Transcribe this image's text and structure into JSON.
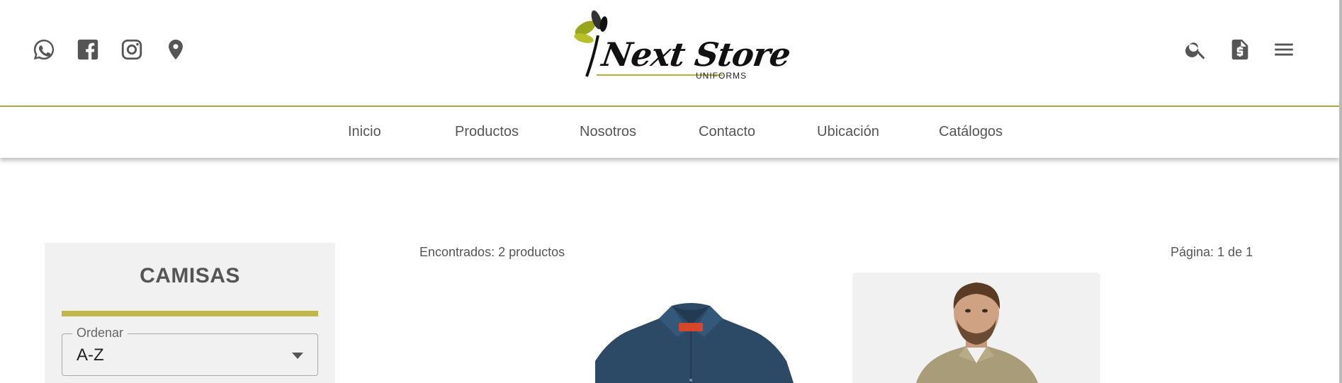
{
  "header": {
    "social_icons": [
      "whatsapp-icon",
      "facebook-icon",
      "instagram-icon",
      "location-pin-icon"
    ],
    "logo": {
      "brand": "Next Store",
      "sub": "UNIFORMS"
    },
    "tool_icons": [
      "search-icon",
      "invoice-dollar-icon",
      "hamburger-menu-icon"
    ]
  },
  "nav": {
    "items": [
      {
        "label": "Inicio"
      },
      {
        "label": "Productos"
      },
      {
        "label": "Nosotros"
      },
      {
        "label": "Contacto"
      },
      {
        "label": "Ubicación"
      },
      {
        "label": "Catálogos"
      }
    ]
  },
  "sidebar": {
    "title": "CAMISAS",
    "sort": {
      "legend": "Ordenar",
      "value": "A-Z"
    }
  },
  "results": {
    "count_text": "Encontrados: 2 productos",
    "page_text": "Página: 1 de 1"
  },
  "colors": {
    "accent_gold": "#b7a63f",
    "sidebar_bar": "#c2b54b",
    "icon_gray": "#555555",
    "shirt_navy": "#2c4a66",
    "shirt_khaki": "#a99c79"
  }
}
